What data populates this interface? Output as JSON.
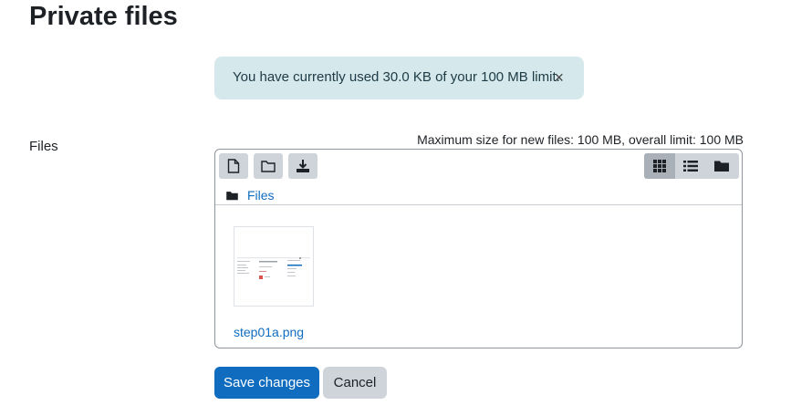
{
  "page": {
    "title": "Private files"
  },
  "alert": {
    "message": "You have currently used 30.0 KB of your 100 MB limit.",
    "close_symbol": "×"
  },
  "form": {
    "field_label": "Files",
    "max_size_note": "Maximum size for new files: 100 MB, overall limit: 100 MB"
  },
  "filemanager": {
    "toolbar": {
      "buttons": [
        {
          "icon": "add-file-icon",
          "action": "Add..."
        },
        {
          "icon": "create-folder-icon",
          "action": "Create folder"
        },
        {
          "icon": "download-icon",
          "action": "Download"
        }
      ],
      "views": [
        {
          "icon": "grid-view-icon",
          "active": true
        },
        {
          "icon": "list-view-icon",
          "active": false
        },
        {
          "icon": "tree-view-icon",
          "active": false
        }
      ]
    },
    "path": {
      "root_label": "Files"
    },
    "files": [
      {
        "name": "step01a.png"
      }
    ]
  },
  "actions": {
    "save_label": "Save changes",
    "cancel_label": "Cancel"
  },
  "colors": {
    "primary": "#0f6cbf",
    "alert_bg": "#d5e8ec",
    "secondary_btn": "#ced4da"
  }
}
